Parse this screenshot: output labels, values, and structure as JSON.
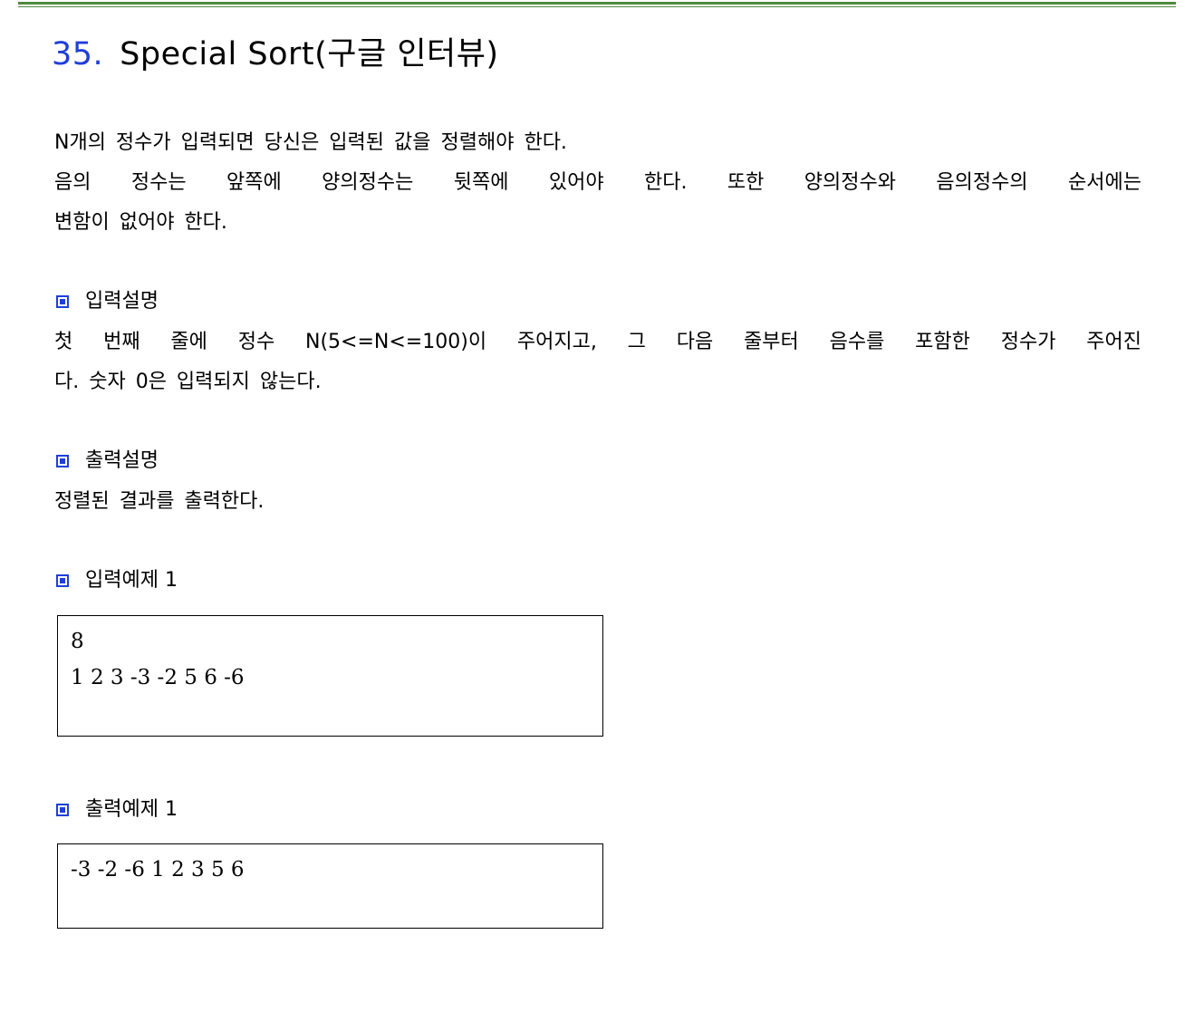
{
  "title": {
    "number": "35.",
    "text": "Special Sort(구글 인터뷰)"
  },
  "description": {
    "lines": [
      "N개의 정수가 입력되면 당신은 입력된 값을 정렬해야 한다.",
      "음의 정수는 앞쪽에 양의정수는 뒷쪽에 있어야 한다. 또한 양의정수와 음의정수의 순서에는",
      "변함이 없어야 한다."
    ]
  },
  "input_spec": {
    "heading": "입력설명",
    "lines": [
      "첫 번째 줄에 정수 N(5<=N<=100)이 주어지고, 그 다음 줄부터 음수를 포함한 정수가 주어진",
      "다. 숫자 0은 입력되지 않는다."
    ]
  },
  "output_spec": {
    "heading": "출력설명",
    "lines": [
      "정렬된 결과를 출력한다."
    ]
  },
  "input_example": {
    "heading": "입력예제 1",
    "lines": [
      "8",
      "1 2 3 -3 -2 5 6 -6"
    ]
  },
  "output_example": {
    "heading": "출력예제 1",
    "lines": [
      "-3 -2 -6 1 2 3 5 6"
    ]
  },
  "colors": {
    "accent_blue": "#1f3fd8",
    "rule_green": "#4f8a3c"
  }
}
